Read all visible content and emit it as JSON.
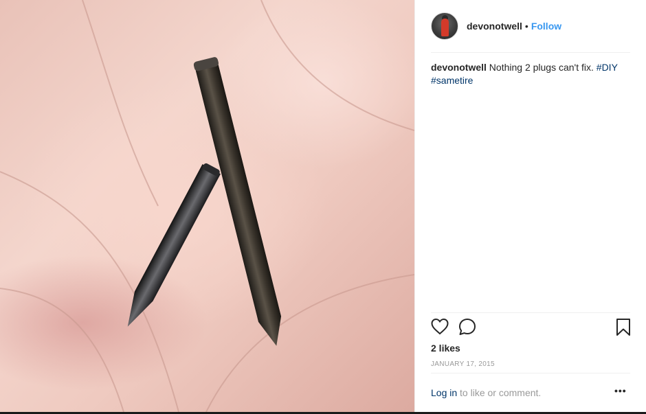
{
  "header": {
    "username": "devonotwell",
    "separator": "•",
    "follow_label": "Follow"
  },
  "caption": {
    "username": "devonotwell",
    "text": "Nothing 2 plugs can't fix.",
    "hashtags": [
      "#DIY",
      "#sametire"
    ]
  },
  "icons": {
    "like": "heart-icon",
    "comment": "comment-icon",
    "save": "bookmark-icon",
    "more": "more-options-icon"
  },
  "stats": {
    "likes": "2 likes",
    "date": "JANUARY 17, 2015"
  },
  "footer": {
    "login_link": "Log in",
    "login_text": " to like or comment.",
    "more_label": "•••"
  },
  "colors": {
    "link": "#3897f0",
    "hashtag": "#003569",
    "muted": "#999999",
    "text": "#262626"
  }
}
